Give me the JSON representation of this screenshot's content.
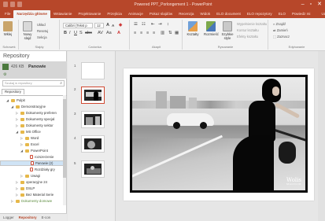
{
  "window": {
    "title": "Powered PPT_Porlongement 1 - PowerPoint",
    "controls": [
      "–",
      "▫",
      "✕"
    ]
  },
  "ribbon": {
    "tabs": [
      "File",
      "Narzędzia główne",
      "Wstawianie",
      "Projektowanie",
      "Przejścia",
      "Animacje",
      "Pokaz slajdów",
      "Recenzja",
      "Widok",
      "ELO document",
      "ELO repozytory",
      "ELO"
    ],
    "active_tab": "Narzędzia główne",
    "right_items": [
      "Powiedz mi",
      "Udostępnij"
    ],
    "groups": {
      "clipboard": {
        "paste": "Wklej",
        "label": "Schowek"
      },
      "slides": {
        "new_slide": "Nowy slajd",
        "layout": "Układ",
        "reset": "Resetuj",
        "section": "Sekcja",
        "label": "Slajdy"
      },
      "font": {
        "font_name": "Calibri (Tekst p",
        "font_size": "12",
        "label": "Czcionka"
      },
      "paragraph": {
        "label": "Akapit"
      },
      "drawing": {
        "shapes": "Kształty",
        "arrange": "Rozmieść",
        "quick_styles": "Szybkie style",
        "fill": "Wypełnienie kształtu",
        "outline": "Kontur kształtu",
        "effects": "Efekty kształtu",
        "label": "Rysowanie"
      },
      "editing": {
        "find": "Znajdź",
        "replace": "Zamień",
        "select": "Zaznacz",
        "label": "Edytowanie"
      }
    }
  },
  "left_pane": {
    "title": "Repository",
    "file_size": "426 KB",
    "item_name": "Panowie",
    "search_placeholder": "Szukaj w repository",
    "repo_tab": "Repository",
    "tree": [
      {
        "label": "Pulpit",
        "depth": 1,
        "type": "folder",
        "expanded": true
      },
      {
        "label": "Demonstracyjne",
        "depth": 2,
        "type": "folder",
        "expanded": true
      },
      {
        "label": "Dokumenty preferen",
        "depth": 3,
        "type": "folder"
      },
      {
        "label": "Dokumenty specjal",
        "depth": 3,
        "type": "folder"
      },
      {
        "label": "Dokumenty sektor",
        "depth": 3,
        "type": "folder"
      },
      {
        "label": "MS Office",
        "depth": 3,
        "type": "folder",
        "expanded": true
      },
      {
        "label": "Word",
        "depth": 4,
        "type": "folder"
      },
      {
        "label": "Excel",
        "depth": 4,
        "type": "folder"
      },
      {
        "label": "PowerPoint",
        "depth": 4,
        "type": "folder",
        "expanded": true
      },
      {
        "label": "rozszerzenie",
        "depth": 5,
        "type": "doc"
      },
      {
        "label": "Panowie (2)",
        "depth": 5,
        "type": "doc",
        "selected": true
      },
      {
        "label": "Rozdziały gry",
        "depth": 5,
        "type": "doc"
      },
      {
        "label": "Uwagi",
        "depth": 4,
        "type": "folder"
      },
      {
        "label": "operacyjne 24",
        "depth": 3,
        "type": "folder"
      },
      {
        "label": "DSLP",
        "depth": 3,
        "type": "folder"
      },
      {
        "label": "Bez Material Serie",
        "depth": 3,
        "type": "folder"
      },
      {
        "label": "Dokumenty domowe",
        "depth": 2,
        "type": "folder",
        "muted": true
      }
    ],
    "bottom_tabs": [
      "Logger",
      "Repository",
      "E-con"
    ],
    "active_bottom_tab": "Repository"
  },
  "thumbnails": {
    "numbers": [
      "1",
      "2",
      "3",
      "4",
      "5"
    ],
    "current": "2"
  },
  "slide": {
    "watermark": "Wolis",
    "watermark_sub": "MAGNUM"
  },
  "colors": {
    "accent": "#b7472a",
    "selection": "#cfe3f5",
    "current_slide_border": "#d04a32"
  }
}
